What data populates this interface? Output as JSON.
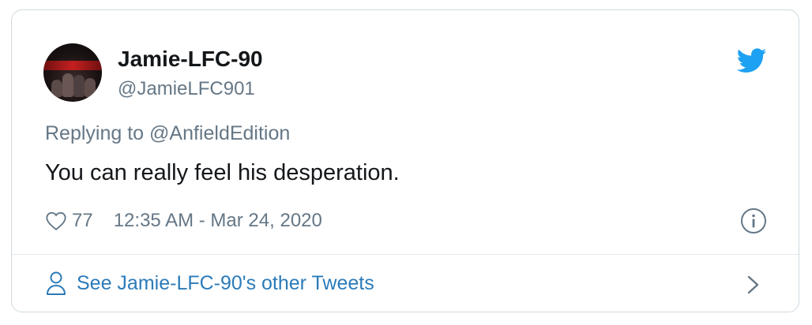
{
  "user": {
    "display_name": "Jamie-LFC-90",
    "handle": "@JamieLFC901"
  },
  "tweet": {
    "reply_prefix": "Replying to ",
    "reply_to": "@AnfieldEdition",
    "text": "You can really feel his desperation.",
    "like_count": "77",
    "timestamp": "12:35 AM - Mar 24, 2020"
  },
  "footer": {
    "link_text": "See Jamie-LFC-90's other Tweets"
  },
  "icons": {
    "brand": "twitter-bird-icon",
    "like": "heart-icon",
    "info": "info-icon",
    "profile": "person-icon",
    "next": "chevron-right-icon"
  },
  "colors": {
    "brand_blue": "#1da1f2",
    "link_blue": "#2b7bb9",
    "secondary_text": "#657786",
    "primary_text": "#14171a",
    "border": "#cfd9de"
  }
}
